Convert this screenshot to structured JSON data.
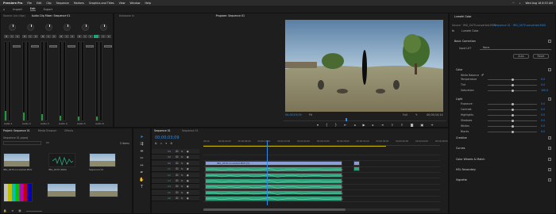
{
  "menubar": {
    "app_name": "Premiere Pro",
    "menus": [
      "File",
      "Edit",
      "Clip",
      "Sequence",
      "Markers",
      "Graphics and Titles",
      "View",
      "Window",
      "Help"
    ],
    "clock": "Wed Aug 16 8:53 AM"
  },
  "workspaces": [
    "Import",
    "Edit",
    "Export"
  ],
  "audio_mixer": {
    "tabs": [
      "Source: (no clips)",
      "Audio Clip Mixer: Sequence 01"
    ],
    "channels": [
      "Audio 1",
      "Audio 2",
      "Audio 3",
      "Audio 4",
      "Audio 5",
      "Audio 6"
    ],
    "levels": [
      0.12,
      0.1,
      0.08,
      0.06,
      0.05,
      0.05
    ]
  },
  "program_monitor": {
    "title_left": "Autosave in",
    "tab": "Program: Sequence 01",
    "timecode": "00;00;03;09",
    "zoom": "Fit",
    "quality": "Full",
    "duration": "00;00;10;14"
  },
  "lumetri": {
    "tab": "Lumetri Color",
    "source": "Source · IMG_0479.converted.MOV",
    "target": "Sequence 01 · IMG_0479.converted.MOV",
    "effect_name": "Lumetri Color",
    "sections": {
      "basic": "Basic Correction",
      "input_lut": "Input LUT",
      "input_lut_value": "None",
      "auto": "Auto",
      "reset": "Reset",
      "color": "Color",
      "white_balance": "White Balance",
      "light": "Light",
      "creative": "Creative",
      "curves": "Curves",
      "color_wheels": "Color Wheels & Match",
      "hsl": "HSL Secondary",
      "vignette": "Vignette"
    },
    "color_params": [
      {
        "name": "Temperature",
        "value": "0.0",
        "pos": 0.5
      },
      {
        "name": "Tint",
        "value": "0.0",
        "pos": 0.5
      },
      {
        "name": "Saturation",
        "value": "100.0",
        "pos": 0.5
      }
    ],
    "light_params": [
      {
        "name": "Exposure",
        "value": "0.0",
        "pos": 0.5
      },
      {
        "name": "Contrast",
        "value": "0.0",
        "pos": 0.5
      },
      {
        "name": "Highlights",
        "value": "0.0",
        "pos": 0.5
      },
      {
        "name": "Shadows",
        "value": "0.0",
        "pos": 0.5
      },
      {
        "name": "Whites",
        "value": "0.0",
        "pos": 0.5
      },
      {
        "name": "Blacks",
        "value": "0.0",
        "pos": 0.5
      }
    ]
  },
  "project": {
    "tabs": [
      "Project: Sequence 01",
      "Media Browser",
      "Effects"
    ],
    "path": "Sequence 01.prproj",
    "count": "5 items",
    "items": [
      {
        "name": "IMG_0479.converted.MOV",
        "duration": "3;00;23"
      },
      {
        "name": "IMG_0479 (WAV)",
        "duration": "10;00;23"
      },
      {
        "name": "IMG_0480.MOV",
        "duration": "1;22;10"
      },
      {
        "name": "Sequence 01",
        "duration": "10;14"
      }
    ]
  },
  "timeline": {
    "tabs": [
      "Sequence 01",
      "Sequence 01"
    ],
    "timecode": "00;00;03;09",
    "ruler": [
      "00;00",
      "00;00;04;00",
      "00;00;08;00",
      "00;00;12;00",
      "00;00;16;00",
      "00;00;20;00",
      "00;00;24;00",
      "00;00;28;00",
      "00;00;32;00",
      "00;00;36;00",
      "00;00;40;00",
      "00;00;44;00",
      "00;00;48;00"
    ],
    "video_tracks": [
      "V3",
      "V2",
      "V1"
    ],
    "audio_tracks": [
      "A1",
      "A2",
      "A3",
      "A4",
      "A5",
      "A6"
    ],
    "clip_label": "IMG_0479.converted.MOV [V]",
    "playhead_fraction": 0.27
  },
  "colors": {
    "accent": "#2d8ceb",
    "video_clip": "#8a9fd6",
    "audio_clip": "#2fa37a",
    "playhead": "#2d8ceb"
  }
}
